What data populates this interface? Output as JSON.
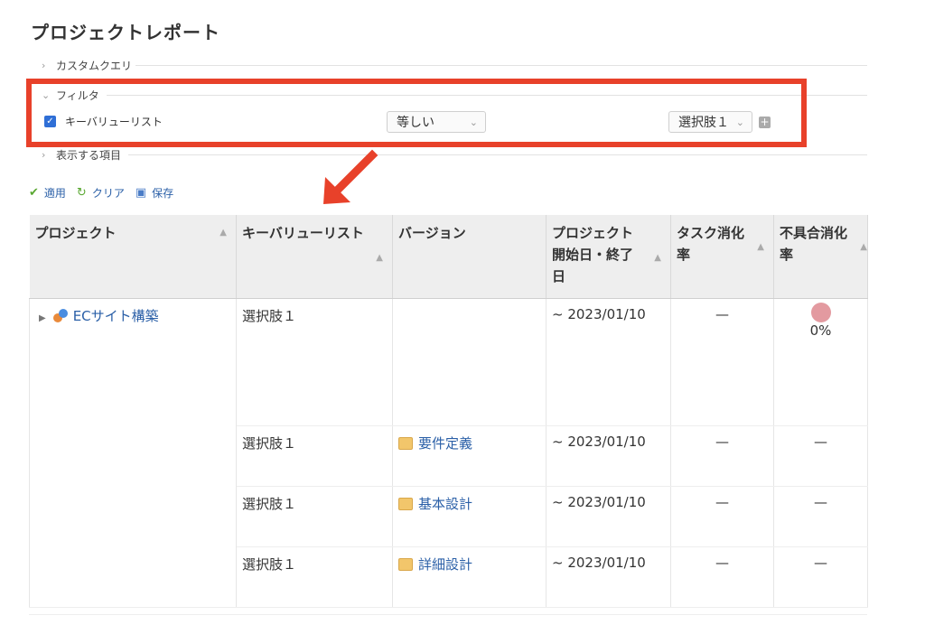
{
  "page": {
    "title": "プロジェクトレポート"
  },
  "sections": {
    "custom_query": "カスタムクエリ",
    "filter": "フィルタ",
    "display_items": "表示する項目"
  },
  "filter": {
    "field_label": "キーバリューリスト",
    "operator": "等しい",
    "value": "選択肢１",
    "checked": true
  },
  "toolbar": {
    "apply": "適用",
    "clear": "クリア",
    "save": "保存"
  },
  "table": {
    "headers": {
      "project": "プロジェクト",
      "kv_list": "キーバリューリスト",
      "version": "バージョン",
      "dates": "プロジェクト開始日・終了日",
      "task_rate": "タスク消化率",
      "defect_rate": "不具合消化率"
    },
    "rows": [
      {
        "project": "ECサイト構築",
        "kv": "選択肢１",
        "version": "",
        "date": "~ 2023/01/10",
        "task": "—",
        "defect": "0%"
      },
      {
        "project": "",
        "kv": "選択肢１",
        "version": "要件定義",
        "date": "~ 2023/01/10",
        "task": "—",
        "defect": "—"
      },
      {
        "project": "",
        "kv": "選択肢１",
        "version": "基本設計",
        "date": "~ 2023/01/10",
        "task": "—",
        "defect": "—"
      },
      {
        "project": "",
        "kv": "選択肢１",
        "version": "詳細設計",
        "date": "~ 2023/01/10",
        "task": "—",
        "defect": "—"
      }
    ]
  },
  "colors": {
    "highlight_box": "#e8412a",
    "link": "#2a5fa7",
    "progress_dot": "#e39aa0",
    "header_bg": "#eeeeee"
  },
  "icons": {
    "apply": "check-icon",
    "clear": "refresh-icon",
    "save": "floppy-icon",
    "version": "package-icon",
    "project": "project-icon"
  }
}
